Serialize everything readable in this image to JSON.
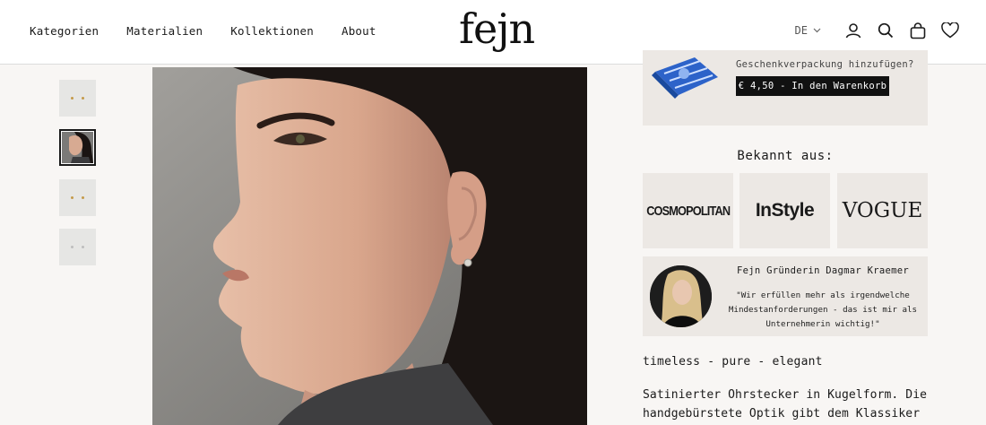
{
  "header": {
    "nav": [
      "Kategorien",
      "Materialien",
      "Kollektionen",
      "About"
    ],
    "logo": "fejn",
    "language": "DE",
    "icons": [
      "user-icon",
      "search-icon",
      "bag-icon",
      "heart-icon"
    ]
  },
  "gallery": {
    "thumbnails": [
      "studs-gold",
      "model-profile",
      "studs-gold-2",
      "studs-silver"
    ],
    "active_index": 1
  },
  "gift": {
    "text": "Geschenkverpackung hinzufügen?",
    "button": "€ 4,50 - In den Warenkorb"
  },
  "known_from": {
    "title": "Bekannt aus:",
    "logos": [
      "COSMOPOLITAN",
      "InStyle",
      "VOGUE"
    ]
  },
  "founder": {
    "name": "Fejn Gründerin Dagmar Kraemer",
    "quote": "\"Wir erfüllen mehr als irgendwelche Mindestanforderungen - das ist mir als Unternehmerin wichtig!\""
  },
  "product": {
    "tagline": "timeless - pure - elegant",
    "description": "Satinierter Ohrstecker in Kugelform. Die handgebürstete Optik gibt dem Klassiker einen"
  },
  "colors": {
    "page_bg": "#f8f6f4",
    "box_bg": "#ece8e4",
    "accent": "#111111",
    "gold": "#c49a4a"
  }
}
